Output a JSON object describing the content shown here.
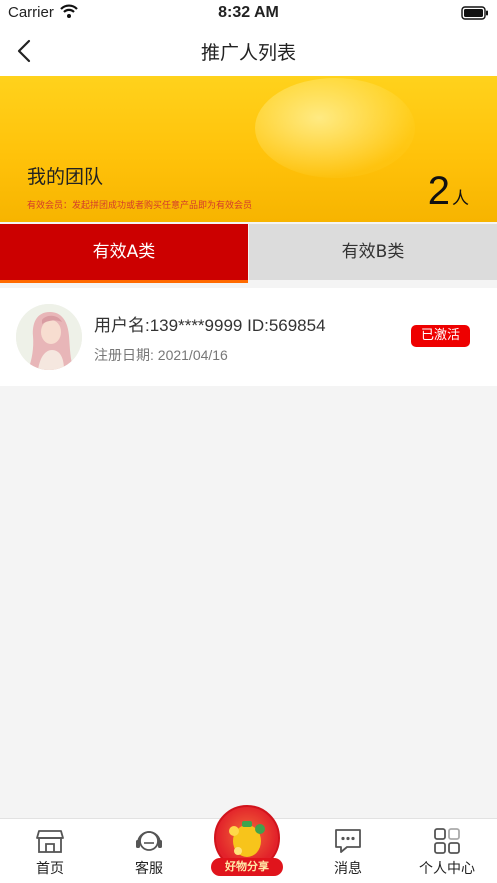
{
  "status_bar": {
    "carrier": "Carrier",
    "time": "8:32 AM"
  },
  "nav": {
    "title": "推广人列表",
    "back_icon": "chevron-left-icon"
  },
  "banner": {
    "team_title": "我的团队",
    "note": "有效会员：发起拼团成功或者购买任意产品即为有效会员",
    "count": "2",
    "count_unit": "人"
  },
  "tabs": [
    {
      "label": "有效A类",
      "active": true
    },
    {
      "label": "有效B类",
      "active": false
    }
  ],
  "members": [
    {
      "username_line": "用户名:139****9999 ID:569854",
      "reg_date": "注册日期: 2021/04/16",
      "status": "已激活"
    }
  ],
  "tab_bar": {
    "items": [
      {
        "label": "首页",
        "icon": "shop-icon"
      },
      {
        "label": "客服",
        "icon": "headset-icon"
      },
      {
        "label": "消息",
        "icon": "chat-icon"
      },
      {
        "label": "个人中心",
        "icon": "grid-icon"
      }
    ],
    "center_label": "好物分享"
  },
  "colors": {
    "accent_red": "#cc0000",
    "banner_yellow": "#ffc20a",
    "tab_inactive": "#dcdcdc",
    "badge_red": "#ee0000"
  }
}
